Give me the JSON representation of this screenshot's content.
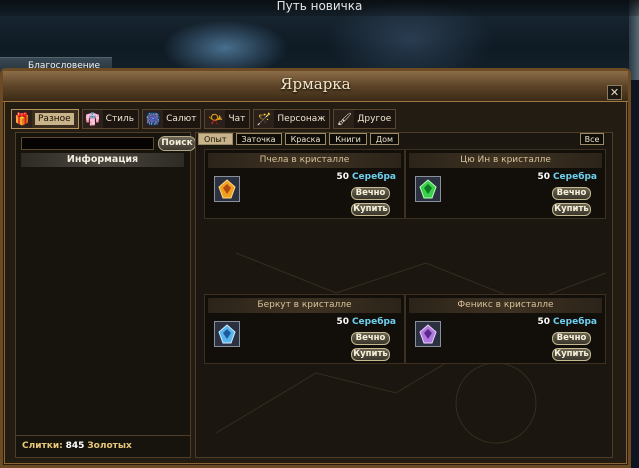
{
  "hud": {
    "top_title": "Путь новичка",
    "blessing_label": "Благословение"
  },
  "window": {
    "title": "Ярмарка",
    "close_symbol": "✕"
  },
  "tabs": [
    {
      "label": "Разное",
      "icon": "gift-icon",
      "glyph": "🎁",
      "active": true
    },
    {
      "label": "Стиль",
      "icon": "costume-icon",
      "glyph": "👘",
      "active": false
    },
    {
      "label": "Салют",
      "icon": "firework-icon",
      "glyph": "🎆",
      "active": false
    },
    {
      "label": "Чат",
      "icon": "horn-icon",
      "glyph": "📯",
      "active": false
    },
    {
      "label": "Персонаж",
      "icon": "wand-icon",
      "glyph": "🪄",
      "active": false
    },
    {
      "label": "Другое",
      "icon": "brush-icon",
      "glyph": "🖌",
      "active": false
    }
  ],
  "left": {
    "search_value": "",
    "search_button": "Поиск",
    "info_item": "Информация",
    "footer_label": "Слитки:",
    "footer_value": "845",
    "footer_currency": "Золотых"
  },
  "filters": [
    {
      "label": "Опыт",
      "active": true
    },
    {
      "label": "Заточка",
      "active": false
    },
    {
      "label": "Краска",
      "active": false
    },
    {
      "label": "Книги",
      "active": false
    },
    {
      "label": "Дом",
      "active": false
    }
  ],
  "all_button": "Все",
  "items": [
    {
      "title": "Пчела в кристалле",
      "price": "50",
      "currency": "Серебра",
      "duration": "Вечно",
      "buy": "Купить",
      "icon": "amber-crystal-icon",
      "color": "#f0a020"
    },
    {
      "title": "Цю Ин в кристалле",
      "price": "50",
      "currency": "Серебра",
      "duration": "Вечно",
      "buy": "Купить",
      "icon": "green-crystal-icon",
      "color": "#3cd04a"
    },
    {
      "title": "Беркут в кристалле",
      "price": "50",
      "currency": "Серебра",
      "duration": "Вечно",
      "buy": "Купить",
      "icon": "blue-crystal-icon",
      "color": "#5ab4f0"
    },
    {
      "title": "Феникс в кристалле",
      "price": "50",
      "currency": "Серебра",
      "duration": "Вечно",
      "buy": "Купить",
      "icon": "purple-crystal-icon",
      "color": "#b07ae0"
    }
  ]
}
